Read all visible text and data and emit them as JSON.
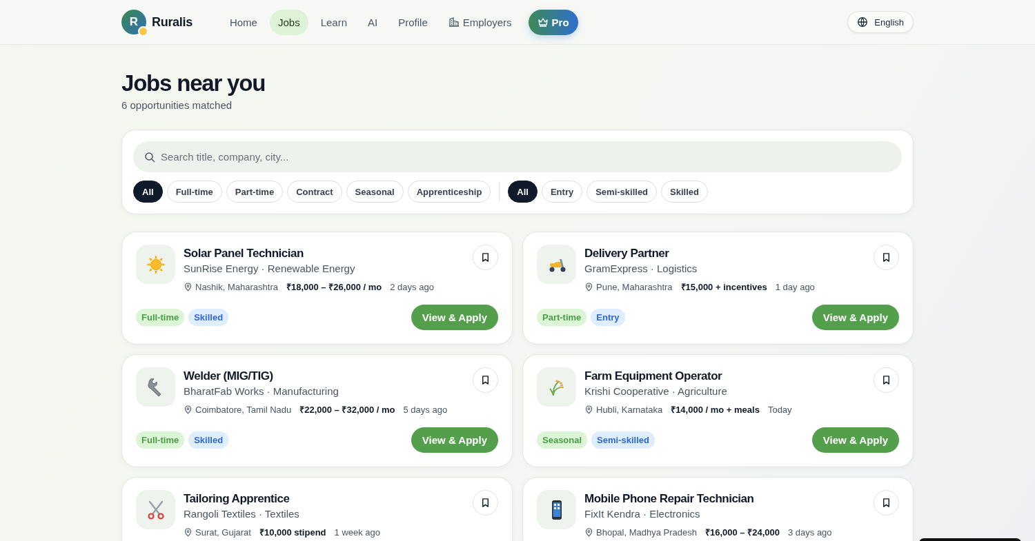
{
  "brand": {
    "initial": "R",
    "name": "Ruralis"
  },
  "nav": [
    {
      "label": "Home",
      "selected": false,
      "kind": "plain"
    },
    {
      "label": "Jobs",
      "selected": true,
      "kind": "plain"
    },
    {
      "label": "Learn",
      "selected": false,
      "kind": "plain"
    },
    {
      "label": "AI",
      "selected": false,
      "kind": "plain"
    },
    {
      "label": "Profile",
      "selected": false,
      "kind": "plain"
    },
    {
      "label": "Employers",
      "selected": false,
      "kind": "employers"
    },
    {
      "label": "Pro",
      "selected": false,
      "kind": "pro"
    }
  ],
  "language": "English",
  "heading": {
    "title": "Jobs near you",
    "subtitle": "6 opportunities matched"
  },
  "search": {
    "placeholder": "Search title, company, city..."
  },
  "type_filters": [
    {
      "label": "All",
      "selected": true
    },
    {
      "label": "Full-time",
      "selected": false
    },
    {
      "label": "Part-time",
      "selected": false
    },
    {
      "label": "Contract",
      "selected": false
    },
    {
      "label": "Seasonal",
      "selected": false
    },
    {
      "label": "Apprenticeship",
      "selected": false
    }
  ],
  "level_filters": [
    {
      "label": "All",
      "selected": true
    },
    {
      "label": "Entry",
      "selected": false
    },
    {
      "label": "Semi-skilled",
      "selected": false
    },
    {
      "label": "Skilled",
      "selected": false
    }
  ],
  "jobs": [
    {
      "title": "Solar Panel Technician",
      "company": "SunRise Energy · Renewable Energy",
      "location": "Nashik, Maharashtra",
      "pay": "₹18,000 – ₹26,000 / mo",
      "posted": "2 days ago",
      "type": "Full-time",
      "level": "Skilled",
      "action": "View & Apply"
    },
    {
      "title": "Delivery Partner",
      "company": "GramExpress · Logistics",
      "location": "Pune, Maharashtra",
      "pay": "₹15,000 + incentives",
      "posted": "1 day ago",
      "type": "Part-time",
      "level": "Entry",
      "action": "View & Apply"
    },
    {
      "title": "Welder (MIG/TIG)",
      "company": "BharatFab Works · Manufacturing",
      "location": "Coimbatore, Tamil Nadu",
      "pay": "₹22,000 – ₹32,000 / mo",
      "posted": "5 days ago",
      "type": "Full-time",
      "level": "Skilled",
      "action": "View & Apply"
    },
    {
      "title": "Farm Equipment Operator",
      "company": "Krishi Cooperative · Agriculture",
      "location": "Hubli, Karnataka",
      "pay": "₹14,000 / mo + meals",
      "posted": "Today",
      "type": "Seasonal",
      "level": "Semi-skilled",
      "action": "View & Apply"
    },
    {
      "title": "Tailoring Apprentice",
      "company": "Rangoli Textiles · Textiles",
      "location": "Surat, Gujarat",
      "pay": "₹10,000 stipend",
      "posted": "1 week ago"
    },
    {
      "title": "Mobile Phone Repair Technician",
      "company": "FixIt Kendra · Electronics",
      "location": "Bhopal, Madhya Pradesh",
      "pay": "₹16,000 – ₹24,000",
      "posted": "3 days ago"
    }
  ]
}
